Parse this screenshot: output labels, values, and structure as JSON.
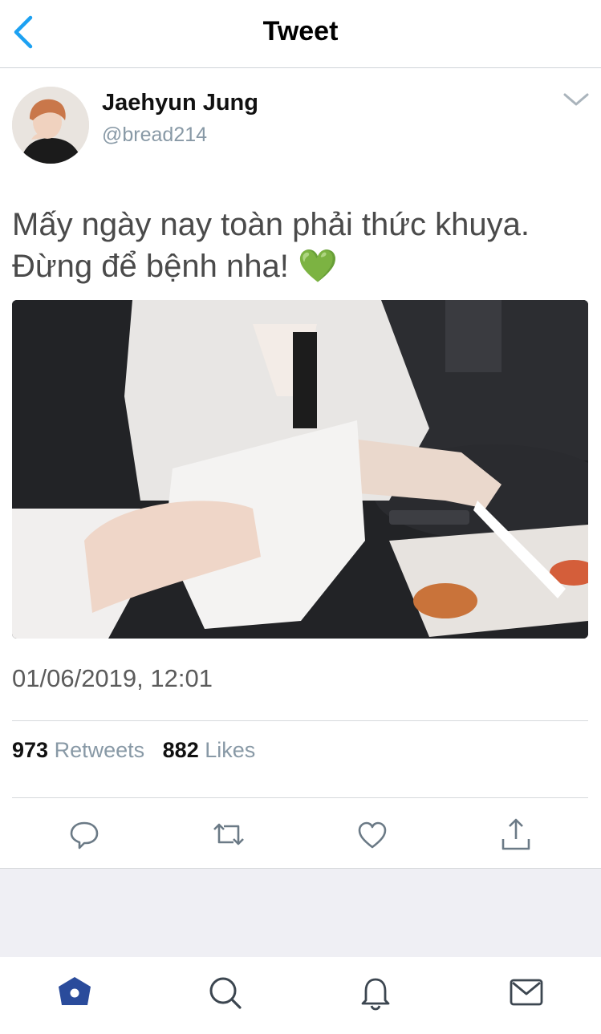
{
  "header": {
    "title": "Tweet",
    "back_icon": "chevron-left-icon"
  },
  "author": {
    "name": "Jaehyun Jung",
    "handle": "@bread214",
    "menu_icon": "chevron-down-icon"
  },
  "tweet": {
    "text": "Mấy ngày nay toàn phải thức khuya.\nĐừng để bệnh nha! 💚",
    "timestamp": "01/06/2019, 12:01"
  },
  "stats": {
    "retweets_count": "973",
    "retweets_label": "Retweets",
    "likes_count": "882",
    "likes_label": "Likes"
  },
  "actions": [
    "reply-icon",
    "retweet-icon",
    "like-icon",
    "share-icon"
  ],
  "tabbar": [
    "home-icon",
    "search-icon",
    "notifications-icon",
    "messages-icon"
  ],
  "colors": {
    "accent": "#1da1f2",
    "active_tab": "#2a4b9b",
    "icon_gray": "#6b7a86",
    "band": "#efeff4"
  }
}
